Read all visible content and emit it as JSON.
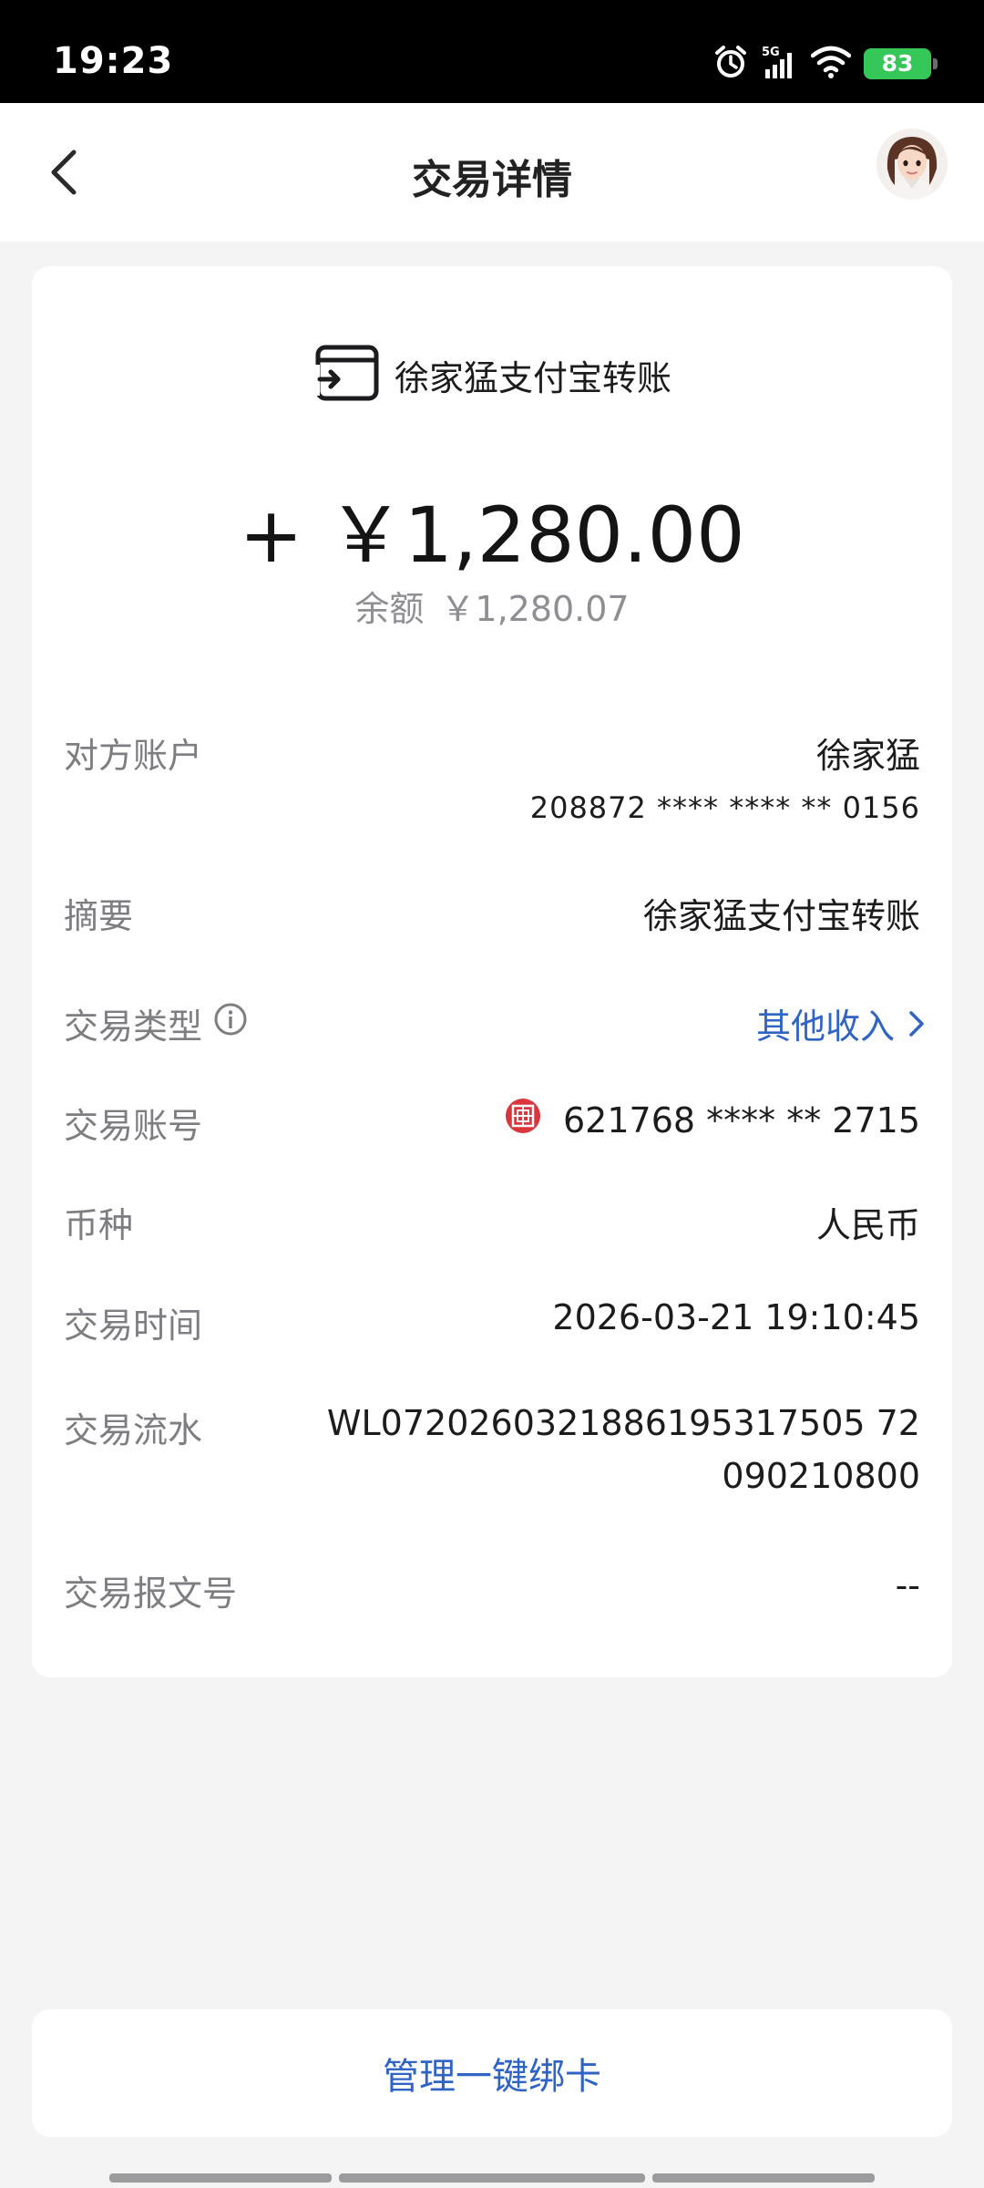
{
  "status_bar": {
    "time": "19:23",
    "network": "5G",
    "battery": "83"
  },
  "nav": {
    "title": "交易详情"
  },
  "summary": {
    "title": "徐家猛支付宝转账",
    "amount": "+ ￥1,280.00",
    "balance_label": "余额",
    "balance_value": "￥1,280.07"
  },
  "details": {
    "counterparty_label": "对方账户",
    "counterparty_name": "徐家猛",
    "counterparty_account": "208872 **** **** ** 0156",
    "memo_label": "摘要",
    "memo_value": "徐家猛支付宝转账",
    "type_label": "交易类型",
    "type_value": "其他收入",
    "account_label": "交易账号",
    "account_value": "621768 **** ** 2715",
    "currency_label": "币种",
    "currency_value": "人民币",
    "time_label": "交易时间",
    "time_value": "2026-03-21 19:10:45",
    "serial_label": "交易流水",
    "serial_line1": "WL0720260321886195317505 72",
    "serial_line2": "090210800",
    "message_label": "交易报文号",
    "message_value": "--"
  },
  "bottom": {
    "button_label": "管理一键绑卡"
  },
  "colors": {
    "accent": "#2f63c4",
    "battery": "#36c759",
    "bank_red": "#d9363e"
  }
}
